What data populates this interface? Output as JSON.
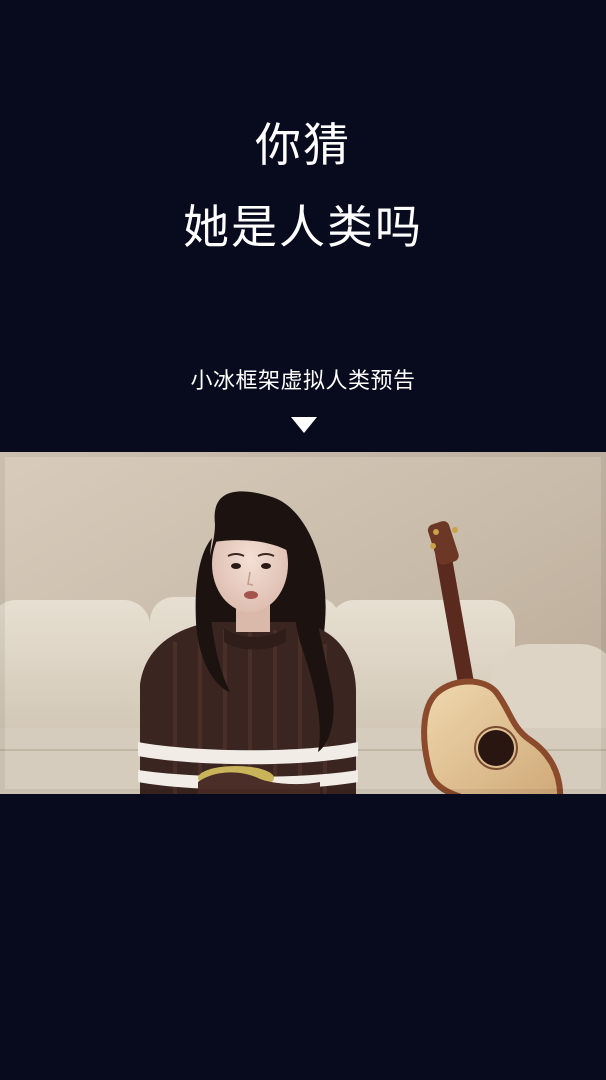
{
  "header": {
    "title_line1": "你猜",
    "title_line2": "她是人类吗"
  },
  "caption": {
    "text": "小冰框架虚拟人类预告",
    "indicator_icon": "triangle-down-icon"
  },
  "video": {
    "subject": "video-thumbnail"
  },
  "colors": {
    "background": "#080b1e",
    "text": "#ffffff"
  }
}
